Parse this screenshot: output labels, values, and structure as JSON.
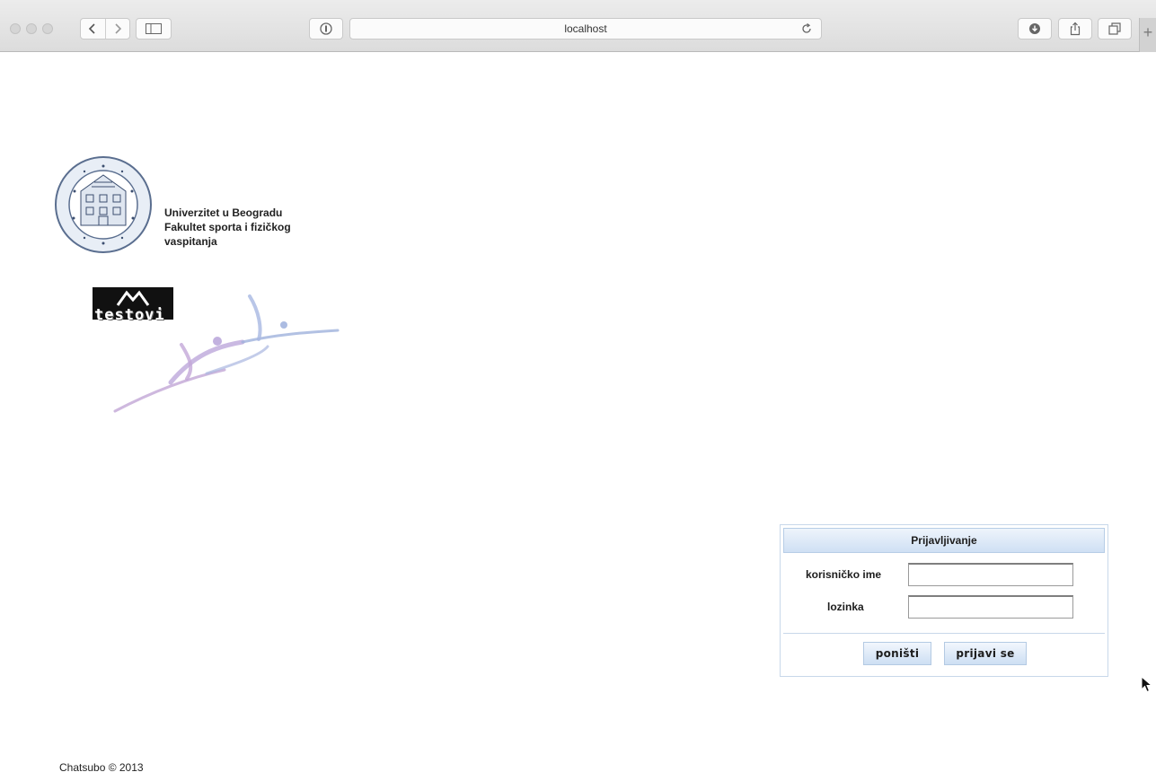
{
  "browser": {
    "address": "localhost",
    "icons": {
      "back": "chevron-left-icon",
      "forward": "chevron-right-icon",
      "sidebar": "sidebar-icon",
      "privacy": "privacy-icon",
      "reload": "reload-icon",
      "download": "download-icon",
      "share": "share-icon",
      "tabs": "tabs-icon",
      "new_tab": "+"
    }
  },
  "header": {
    "university": "Univerzitet u Beogradu",
    "faculty_line1": "Fakultet sporta i fizičkog",
    "faculty_line2": "vaspitanja",
    "testovi_logo": "testovi"
  },
  "login": {
    "title": "Prijavljivanje",
    "username_label": "korisničko ime",
    "username_value": "",
    "password_label": "lozinka",
    "password_value": "",
    "cancel_label": "poništi",
    "submit_label": "prijavi se"
  },
  "footer": {
    "text": "Chatsubo © 2013"
  },
  "colors": {
    "panel_border": "#c8d8ea",
    "panel_header_top": "#eef4fb",
    "panel_header_bottom": "#cfe0f4",
    "button_bottom": "#cddff3"
  }
}
